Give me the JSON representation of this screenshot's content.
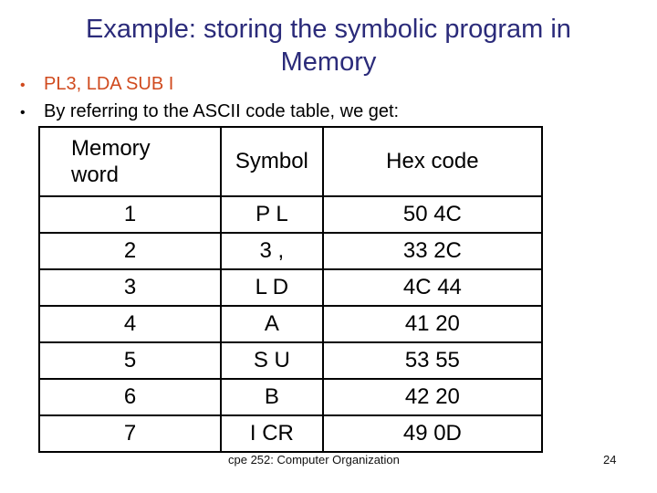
{
  "slide": {
    "title_line1": "Example: storing the symbolic program in",
    "title_line2": "Memory",
    "bullets": [
      {
        "text": "PL3,  LDA SUB I",
        "color": "#d04a1e"
      },
      {
        "text": "By referring to the  ASCII code table, we get:",
        "color": "#000000"
      }
    ],
    "bullet_glyph": "•",
    "table": {
      "headers": [
        "Memory word",
        "Symbol",
        "Hex code"
      ],
      "header_mem_line1": "Memory",
      "header_mem_line2": "word",
      "rows": [
        {
          "word": "1",
          "symbol": "P L",
          "hex": "50 4C"
        },
        {
          "word": "2",
          "symbol": "3 ,",
          "hex": "33 2C"
        },
        {
          "word": "3",
          "symbol": "L D",
          "hex": "4C 44"
        },
        {
          "word": "4",
          "symbol": "A",
          "hex": "41 20"
        },
        {
          "word": "5",
          "symbol": "S U",
          "hex": "53 55"
        },
        {
          "word": "6",
          "symbol": "B",
          "hex": "42 20"
        },
        {
          "word": "7",
          "symbol": "I CR",
          "hex": "49 0D"
        }
      ]
    },
    "footer": "cpe 252: Computer Organization",
    "page_number": "24",
    "colors": {
      "title": "#2b2b7a",
      "accent": "#d04a1e"
    }
  }
}
